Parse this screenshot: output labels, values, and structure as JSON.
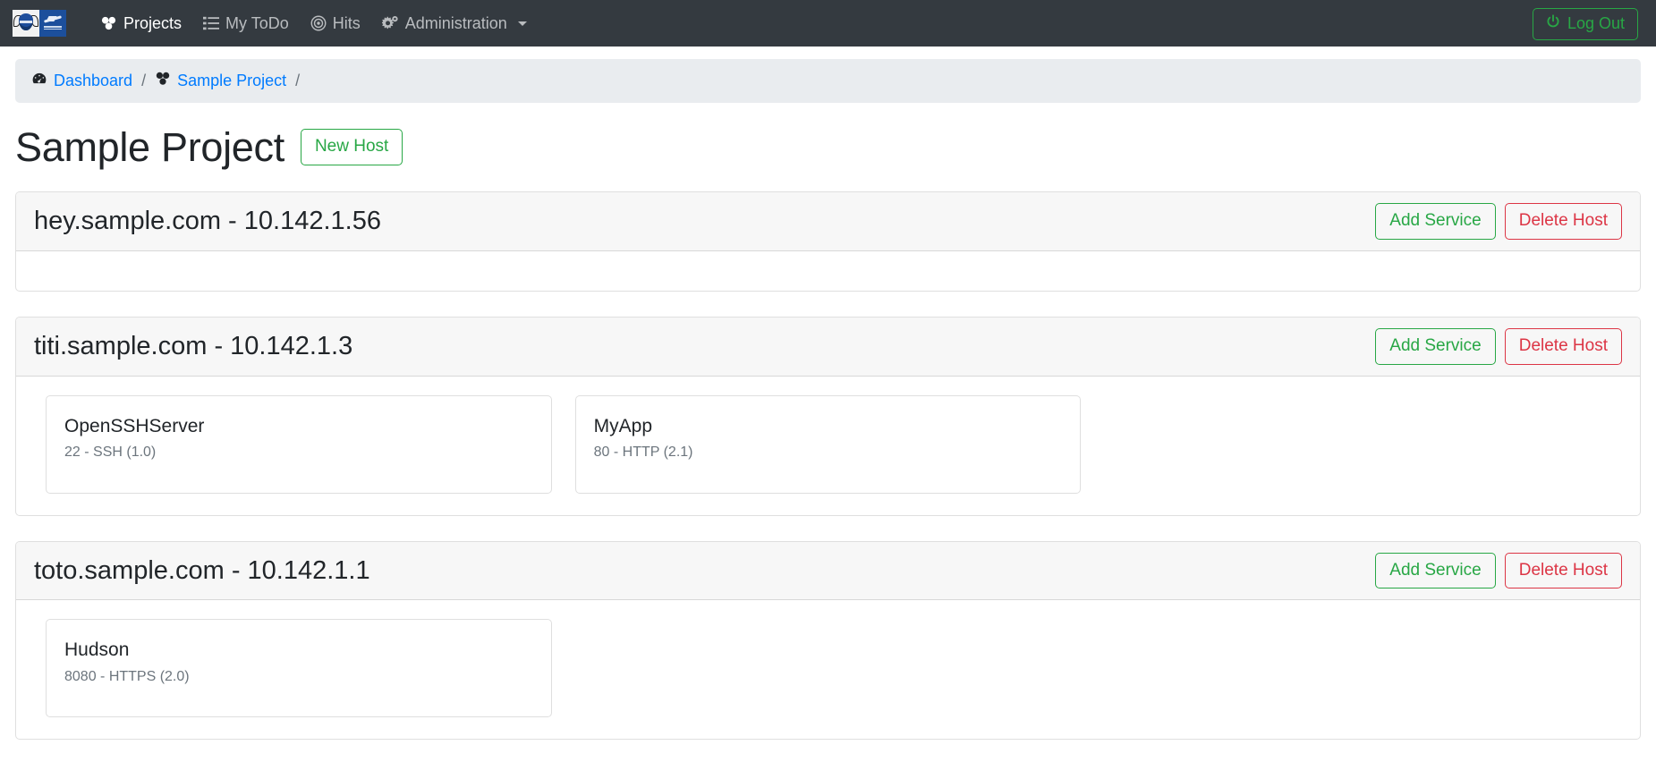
{
  "navbar": {
    "brand_icon_left": "owl-shield-logo-icon",
    "brand_icon_right": "jet-emblem-logo-icon",
    "items": [
      {
        "label": "Projects",
        "icon": "cubes-icon",
        "active": true,
        "caret": false
      },
      {
        "label": "My ToDo",
        "icon": "list-icon",
        "active": false,
        "caret": false
      },
      {
        "label": "Hits",
        "icon": "bullseye-icon",
        "active": false,
        "caret": false
      },
      {
        "label": "Administration",
        "icon": "cogs-icon",
        "active": false,
        "caret": true
      }
    ],
    "logout": {
      "label": "Log Out",
      "icon": "power-off-icon"
    }
  },
  "breadcrumb": {
    "items": [
      {
        "label": "Dashboard",
        "icon": "tachometer-icon"
      },
      {
        "label": "Sample Project",
        "icon": "cubes-icon"
      }
    ],
    "separator": "/"
  },
  "page": {
    "title": "Sample Project",
    "new_host_label": "New Host"
  },
  "actions": {
    "add_service_label": "Add Service",
    "delete_host_label": "Delete Host"
  },
  "colors": {
    "navbar_bg": "#343a40",
    "breadcrumb_bg": "#e9ecef",
    "link": "#007bff",
    "success": "#28a745",
    "danger": "#dc3545",
    "muted": "#6c757d",
    "card_header_bg": "#f7f7f7"
  },
  "hosts": [
    {
      "name": "hey.sample.com - 10.142.1.56",
      "services": []
    },
    {
      "name": "titi.sample.com - 10.142.1.3",
      "services": [
        {
          "title": "OpenSSHServer",
          "detail": "22 - SSH (1.0)"
        },
        {
          "title": "MyApp",
          "detail": "80 - HTTP (2.1)"
        }
      ]
    },
    {
      "name": "toto.sample.com - 10.142.1.1",
      "services": [
        {
          "title": "Hudson",
          "detail": "8080 - HTTPS (2.0)"
        }
      ]
    }
  ]
}
